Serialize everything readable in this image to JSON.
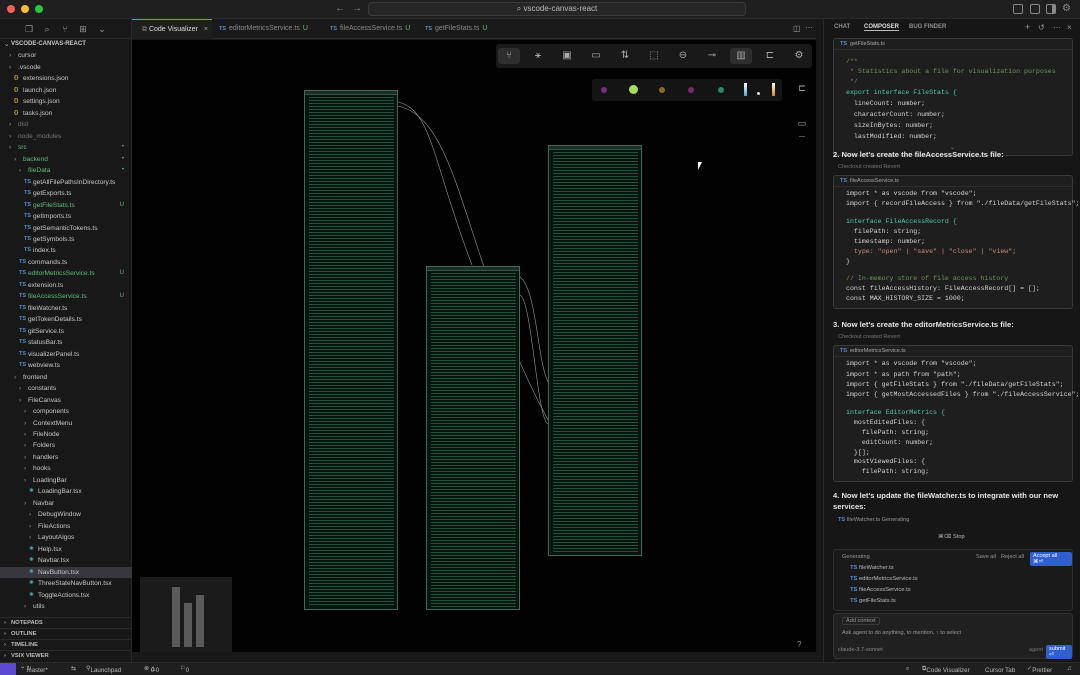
{
  "title_bar": {
    "search_text": "vscode-canvas-react"
  },
  "sidebar": {
    "root": "VSCODE-CANVAS-REACT",
    "items": [
      {
        "label": "cursor",
        "type": "folder",
        "depth": 1,
        "status": ""
      },
      {
        "label": ".vscode",
        "type": "folder",
        "depth": 1,
        "status": ""
      },
      {
        "label": "extensions.json",
        "type": "json",
        "depth": 2,
        "status": ""
      },
      {
        "label": "launch.json",
        "type": "json",
        "depth": 2,
        "status": ""
      },
      {
        "label": "settings.json",
        "type": "json",
        "depth": 2,
        "status": ""
      },
      {
        "label": "tasks.json",
        "type": "json",
        "depth": 2,
        "status": ""
      },
      {
        "label": "dist",
        "type": "folder",
        "depth": 1,
        "status": ""
      },
      {
        "label": "node_modules",
        "type": "folder",
        "depth": 1,
        "status": ""
      },
      {
        "label": "src",
        "type": "folder",
        "depth": 1,
        "status": "•"
      },
      {
        "label": "backend",
        "type": "folder",
        "depth": 2,
        "status": "•"
      },
      {
        "label": "fileData",
        "type": "folder",
        "depth": 3,
        "status": "•"
      },
      {
        "label": "getAllFilePathsInDirectory.ts",
        "type": "ts",
        "depth": 4,
        "status": ""
      },
      {
        "label": "getExports.ts",
        "type": "ts",
        "depth": 4,
        "status": ""
      },
      {
        "label": "getFileStats.ts",
        "type": "ts",
        "depth": 4,
        "status": "U"
      },
      {
        "label": "getImports.ts",
        "type": "ts",
        "depth": 4,
        "status": ""
      },
      {
        "label": "getSemanticTokens.ts",
        "type": "ts",
        "depth": 4,
        "status": ""
      },
      {
        "label": "getSymbols.ts",
        "type": "ts",
        "depth": 4,
        "status": ""
      },
      {
        "label": "index.ts",
        "type": "ts",
        "depth": 4,
        "status": ""
      },
      {
        "label": "commands.ts",
        "type": "ts",
        "depth": 3,
        "status": ""
      },
      {
        "label": "editorMetricsService.ts",
        "type": "ts",
        "depth": 3,
        "status": "U"
      },
      {
        "label": "extension.ts",
        "type": "ts",
        "depth": 3,
        "status": ""
      },
      {
        "label": "fileAccessService.ts",
        "type": "ts",
        "depth": 3,
        "status": "U"
      },
      {
        "label": "fileWatcher.ts",
        "type": "ts",
        "depth": 3,
        "status": ""
      },
      {
        "label": "getTokenDetails.ts",
        "type": "ts",
        "depth": 3,
        "status": ""
      },
      {
        "label": "gitService.ts",
        "type": "ts",
        "depth": 3,
        "status": ""
      },
      {
        "label": "statusBar.ts",
        "type": "ts",
        "depth": 3,
        "status": ""
      },
      {
        "label": "visualizerPanel.ts",
        "type": "ts",
        "depth": 3,
        "status": ""
      },
      {
        "label": "webview.ts",
        "type": "ts",
        "depth": 3,
        "status": ""
      },
      {
        "label": "frontend",
        "type": "folder",
        "depth": 2,
        "status": ""
      },
      {
        "label": "constants",
        "type": "folder",
        "depth": 3,
        "status": ""
      },
      {
        "label": "FileCanvas",
        "type": "folder",
        "depth": 3,
        "status": ""
      },
      {
        "label": "components",
        "type": "folder",
        "depth": 4,
        "status": ""
      },
      {
        "label": "ContextMenu",
        "type": "folder",
        "depth": 4,
        "status": ""
      },
      {
        "label": "FileNode",
        "type": "folder",
        "depth": 4,
        "status": ""
      },
      {
        "label": "Folders",
        "type": "folder",
        "depth": 4,
        "status": ""
      },
      {
        "label": "handlers",
        "type": "folder",
        "depth": 4,
        "status": ""
      },
      {
        "label": "hooks",
        "type": "folder",
        "depth": 4,
        "status": ""
      },
      {
        "label": "LoadingBar",
        "type": "folder",
        "depth": 4,
        "status": ""
      },
      {
        "label": "LoadingBar.tsx",
        "type": "tsx",
        "depth": 5,
        "status": ""
      },
      {
        "label": "Navbar",
        "type": "folder",
        "depth": 4,
        "status": ""
      },
      {
        "label": "DebugWindow",
        "type": "folder",
        "depth": 5,
        "status": ""
      },
      {
        "label": "FileActions",
        "type": "folder",
        "depth": 5,
        "status": ""
      },
      {
        "label": "LayoutAlgos",
        "type": "folder",
        "depth": 5,
        "status": ""
      },
      {
        "label": "Help.tsx",
        "type": "tsx",
        "depth": 5,
        "status": ""
      },
      {
        "label": "Navbar.tsx",
        "type": "tsx",
        "depth": 5,
        "status": ""
      },
      {
        "label": "NavButton.tsx",
        "type": "tsx",
        "depth": 5,
        "status": ""
      },
      {
        "label": "ThreeStateNavButton.tsx",
        "type": "tsx",
        "depth": 5,
        "status": ""
      },
      {
        "label": "ToggleActions.tsx",
        "type": "tsx",
        "depth": 5,
        "status": ""
      },
      {
        "label": "utils",
        "type": "folder",
        "depth": 4,
        "status": ""
      }
    ],
    "sections": [
      "NOTEPADS",
      "OUTLINE",
      "TIMELINE",
      "VSIX VIEWER"
    ]
  },
  "tabs": [
    {
      "label": "Code Visualizer",
      "active": true,
      "status": ""
    },
    {
      "label": "editorMetricsService.ts",
      "active": false,
      "status": "U"
    },
    {
      "label": "fileAccessService.ts",
      "active": false,
      "status": "U"
    },
    {
      "label": "getFileStats.ts",
      "active": false,
      "status": "U"
    }
  ],
  "palette_colors": [
    "#7a2a7a",
    "#a6e05a",
    "#8a6a2a",
    "#7a2a6a",
    "#2a8a6a"
  ],
  "right_panel": {
    "tabs": [
      "CHAT",
      "COMPOSER",
      "BUG FINDER"
    ],
    "block1": {
      "file": "getFileStats.ts",
      "lines": [
        "/**",
        " * Statistics about a file for visualization purposes",
        " */",
        "export interface FileStats {",
        "  lineCount: number;",
        "  characterCount: number;",
        "  sizeInBytes: number;",
        "  lastModified: number;"
      ]
    },
    "step2": "2. Now let's create the fileAccessService.ts file:",
    "note2": "Checkout created  Revert",
    "block2": {
      "file": "fileAccessService.ts",
      "lines": [
        "import * as vscode from \"vscode\";",
        "import { recordFileAccess } from \"./fileData/getFileStats\";",
        "",
        "interface FileAccessRecord {",
        "  filePath: string;",
        "  timestamp: number;",
        "  type: \"open\" | \"save\" | \"close\" | \"view\";",
        "}",
        "",
        "// In-memory store of file access history",
        "const fileAccessHistory: FileAccessRecord[] = [];",
        "const MAX_HISTORY_SIZE = 1000;"
      ]
    },
    "step3": "3. Now let's create the editorMetricsService.ts file:",
    "note3": "Checkout created  Revert",
    "block3": {
      "file": "editorMetricsService.ts",
      "lines": [
        "import * as vscode from \"vscode\";",
        "import * as path from \"path\";",
        "import { getFileStats } from \"./fileData/getFileStats\";",
        "import { getMostAccessedFiles } from \"./fileAccessService\";",
        "",
        "interface EditorMetrics {",
        "  mostEditedFiles: {",
        "    filePath: string;",
        "    editCount: number;",
        "  }[];",
        "  mostViewedFiles: {",
        "    filePath: string;"
      ]
    },
    "step4": "4. Now let's update the fileWatcher.ts to integrate with our new services:",
    "step4_file": "fileWatcher.ts  Generating",
    "stop": "⌘⌫  Stop",
    "generating": "Generating",
    "gen_actions": [
      "Save all",
      "Reject all",
      "Accept all ⌘⏎"
    ],
    "gen_files": [
      "fileWatcher.ts",
      "editorMetricsService.ts",
      "fileAccessService.ts",
      "getFileStats.ts"
    ],
    "add_context": "Add context",
    "input_placeholder": "Ask agent to do anything, to mention, ↑ to select",
    "model": "claude-3.7-sonnet",
    "agent_label": "agent",
    "submit": "submit ⏎"
  },
  "status": {
    "branch": "master*",
    "launchpad": "Launchpad",
    "errors": "0",
    "warnings": "0",
    "ports": "0",
    "right": [
      "Code Visualizer",
      "Cursor Tab",
      "Prettier"
    ]
  }
}
